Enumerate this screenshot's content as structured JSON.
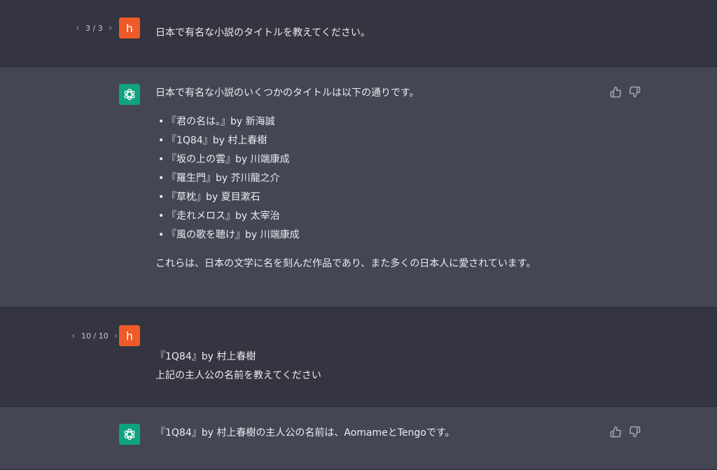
{
  "messages": [
    {
      "role": "user",
      "pager": "3 / 3",
      "avatar": "h",
      "lines": [
        "日本で有名な小説のタイトルを教えてください。"
      ]
    },
    {
      "role": "assistant",
      "intro": "日本で有名な小説のいくつかのタイトルは以下の通りです。",
      "items": [
        "『君の名は。』by 新海誠",
        "『1Q84』by 村上春樹",
        "『坂の上の雲』by 川端康成",
        "『羅生門』by 芥川龍之介",
        "『草枕』by 夏目漱石",
        "『走れメロス』by 太宰治",
        "『風の歌を聴け』by 川端康成"
      ],
      "outro": "これらは、日本の文学に名を刻んだ作品であり、また多くの日本人に愛されています。"
    },
    {
      "role": "user",
      "pager": "10 / 10",
      "avatar": "h",
      "lines": [
        "『1Q84』by 村上春樹",
        "上記の主人公の名前を教えてください"
      ]
    },
    {
      "role": "assistant",
      "intro": "『1Q84』by 村上春樹の主人公の名前は、AomameとTengoです。"
    }
  ],
  "icons": {
    "prev": "chevron-left-icon",
    "next": "chevron-right-icon",
    "thumbs_up": "thumbs-up-icon",
    "thumbs_down": "thumbs-down-icon",
    "assistant_logo": "openai-logo-icon"
  },
  "colors": {
    "user_bg": "#343541",
    "assistant_bg": "#444654",
    "user_avatar": "#f05a28",
    "assistant_avatar": "#10a37f"
  }
}
